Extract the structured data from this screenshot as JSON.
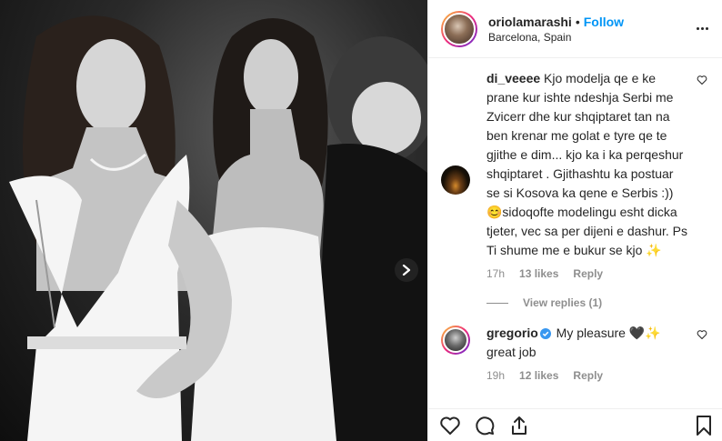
{
  "post": {
    "username": "oriolamarashi",
    "separator": "•",
    "follow_label": "Follow",
    "location": "Barcelona, Spain"
  },
  "comments": [
    {
      "username": "di_veeee",
      "text": " Kjo modelja qe e ke prane kur ishte ndeshja Serbi me Zvicerr dhe kur shqiptaret tan na ben krenar me golat e tyre qe te gjithe e dim... kjo ka i ka perqeshur shqiptaret . Gjithashtu ka postuar se si Kosova ka qene e Serbis :)) 😊sidoqofte modelingu esht dicka tjeter, vec sa per dijeni e dashur. Ps Ti shume me e bukur se kjo ✨",
      "time": "17h",
      "likes": "13 likes",
      "reply": "Reply",
      "view_replies": "View replies (1)"
    },
    {
      "username": "gregorio",
      "text": " My pleasure 🖤✨\ngreat job",
      "time": "19h",
      "likes": "12 likes",
      "reply": "Reply"
    }
  ],
  "colors": {
    "accent": "#0095f6",
    "muted": "#8e8e8e",
    "text": "#262626",
    "verified": "#3897f0"
  },
  "icons": [
    "more-icon",
    "chevron-right-icon",
    "heart-icon",
    "comment-icon",
    "share-icon",
    "bookmark-icon",
    "verified-icon"
  ]
}
